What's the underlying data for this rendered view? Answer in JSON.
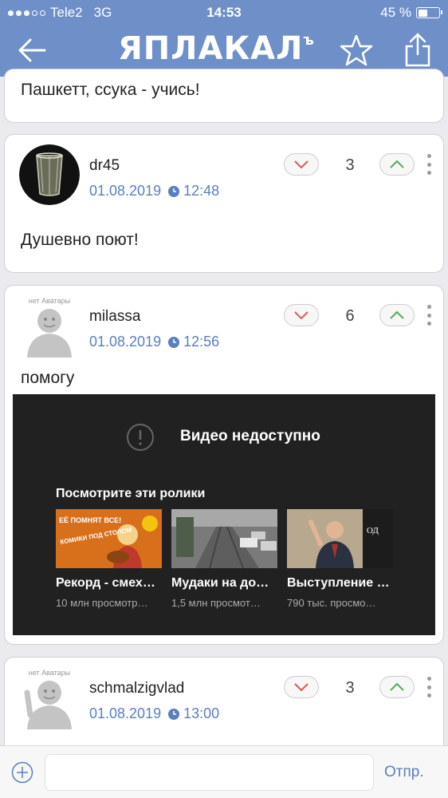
{
  "status_bar": {
    "carrier": "Tele2",
    "network": "3G",
    "time": "14:53",
    "battery": "45 %",
    "battery_level": 0.45
  },
  "nav": {
    "logo": "ЯПЛАКАЛ",
    "logo_mark": "ъ"
  },
  "comments": [
    {
      "text": "Пашкетт, ссука - учись!"
    },
    {
      "username": "dr45",
      "date": "01.08.2019",
      "time": "12:48",
      "score": "3",
      "text": "Душевно поют!"
    },
    {
      "username": "milassa",
      "date": "01.08.2019",
      "time": "12:56",
      "score": "6",
      "text": "помогу",
      "avatar_text": "нет Аватары"
    },
    {
      "username": "schmalzigvlad",
      "date": "01.08.2019",
      "time": "13:00",
      "score": "3",
      "avatar_text": "нет Аватары"
    }
  ],
  "video": {
    "unavailable": "Видео недоступно",
    "suggest_heading": "Посмотрите эти ролики",
    "suggestions": [
      {
        "title": "Рекорд - смех…",
        "views": "10 млн просмотр…",
        "thumb_text": "ЕЁ ПОМНЯТ ВСЕ!",
        "thumb_sub": "КОМИКИ ПОД СТОЛОМ"
      },
      {
        "title": "Мудаки на до…",
        "views": "1,5 млн просмот…"
      },
      {
        "title": "Выступление …",
        "views": "790 тыс. просмо…",
        "thumb_text": "ОД"
      }
    ]
  },
  "composer": {
    "placeholder": "",
    "send": "Отпр."
  },
  "colors": {
    "header": "#6f8fc8",
    "accent": "#5a7fbf",
    "video_bg": "#212121"
  }
}
